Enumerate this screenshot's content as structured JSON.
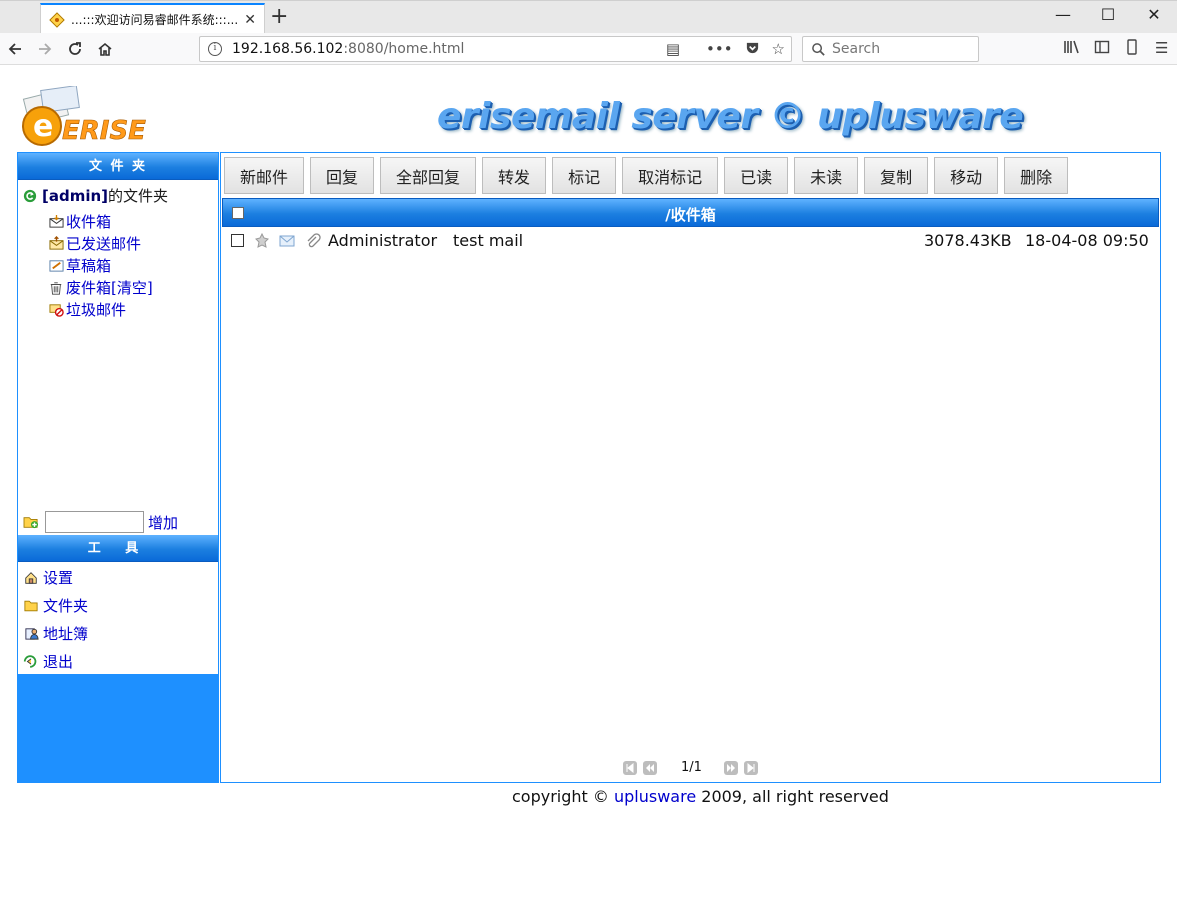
{
  "browser": {
    "tab_title": "...:::欢迎访问易睿邮件系统:::...",
    "url_host": "192.168.56.102",
    "url_rest": ":8080/home.html",
    "search_placeholder": "Search"
  },
  "header": {
    "logo_text": "ERISE",
    "banner_text": "erisemail server © uplusware"
  },
  "sidebar": {
    "folders_heading": "文 件 夹",
    "owner_user": "[admin]",
    "owner_suffix": "的文件夹",
    "folders": [
      {
        "label": "收件箱",
        "icon": "inbox-icon"
      },
      {
        "label": "已发送邮件",
        "icon": "sent-icon"
      },
      {
        "label": "草稿箱",
        "icon": "drafts-icon"
      },
      {
        "label": "废件箱[清空]",
        "icon": "trash-icon"
      },
      {
        "label": "垃圾邮件",
        "icon": "spam-icon"
      }
    ],
    "add_label": "增加",
    "tools_heading": "工 具",
    "tools": [
      {
        "label": "设置",
        "icon": "settings-icon"
      },
      {
        "label": "文件夹",
        "icon": "folder-icon"
      },
      {
        "label": "地址簿",
        "icon": "address-book-icon"
      },
      {
        "label": "退出",
        "icon": "logout-icon"
      }
    ]
  },
  "toolbar": {
    "buttons": [
      "新邮件",
      "回复",
      "全部回复",
      "转发",
      "标记",
      "取消标记",
      "已读",
      "未读",
      "复制",
      "移动",
      "删除"
    ]
  },
  "mail_list": {
    "title": "/收件箱",
    "rows": [
      {
        "from": "Administrator",
        "subject": "test mail",
        "size": "3078.43KB",
        "date": "18-04-08 09:50"
      }
    ]
  },
  "pager": {
    "page_text": "1/1"
  },
  "footer": {
    "prefix": "copyright © ",
    "link": "uplusware",
    "suffix": " 2009, all right reserved"
  }
}
